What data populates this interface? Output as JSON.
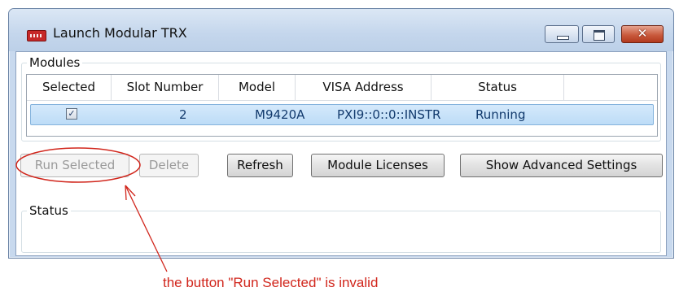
{
  "window": {
    "title": "Launch Modular TRX",
    "icon": "app-logo-icon",
    "controls": {
      "minimize": "minimize-icon",
      "maximize": "maximize-icon",
      "close_glyph": "✕"
    }
  },
  "modules": {
    "legend": "Modules",
    "columns": [
      "Selected",
      "Slot Number",
      "Model",
      "VISA Address",
      "Status"
    ],
    "rows": [
      {
        "selected": true,
        "check_glyph": "✓",
        "slot_number": "2",
        "model": "M9420A",
        "visa_address": "PXI9::0::0::INSTR",
        "status": "Running"
      }
    ]
  },
  "buttons": {
    "run_selected": "Run Selected",
    "delete": "Delete",
    "refresh": "Refresh",
    "module_licenses": "Module Licenses",
    "show_advanced": "Show Advanced Settings"
  },
  "status_group": {
    "legend": "Status"
  },
  "annotation": {
    "text": "the button \"Run Selected\" is invalid",
    "color": "#d1261c"
  },
  "colors": {
    "title_bar": "#c4d6ec",
    "selected_row": "#c9e3fa",
    "close_button": "#c95b3e",
    "disabled_text": "#9a9a9a"
  }
}
